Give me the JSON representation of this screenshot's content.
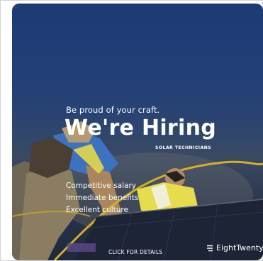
{
  "ad": {
    "tagline": "Be proud of your craft.",
    "headline": "We're Hiring",
    "subheading": "SOLAR TECHNICIANS",
    "benefits": [
      "Competitive salary",
      "Immediate benefits",
      "Excellent culture"
    ],
    "cta": "CLICK FOR DETAILS",
    "brand": "EightTwenty",
    "brand_icon": "eighttwenty-logo-icon",
    "colors": {
      "sky": "#1f3c76",
      "text": "#ffffff",
      "vest": "#e9e04a",
      "shirt": "#3d76c4",
      "rope": "#d8b425",
      "panel": "#1d2639"
    }
  }
}
